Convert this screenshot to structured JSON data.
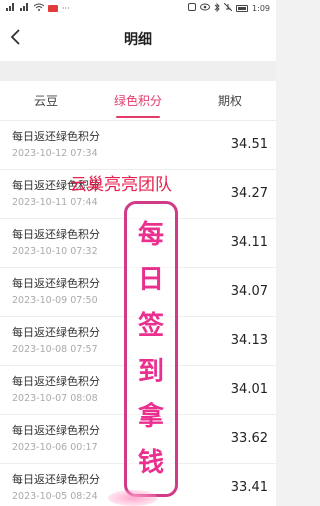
{
  "status_bar": {
    "time": "1:09",
    "battery_level": 0.8
  },
  "header": {
    "title": "明细",
    "back_icon": "chevron-left-icon"
  },
  "tabs": [
    {
      "label": "云豆",
      "active": false
    },
    {
      "label": "绿色积分",
      "active": true
    },
    {
      "label": "期权",
      "active": false
    }
  ],
  "records": [
    {
      "title": "每日返还绿色积分",
      "date": "2023-10-12 07:34",
      "amount": "34.51"
    },
    {
      "title": "每日返还绿色积分",
      "date": "2023-10-11 07:44",
      "amount": "34.27"
    },
    {
      "title": "每日返还绿色积分",
      "date": "2023-10-10 07:32",
      "amount": "34.11"
    },
    {
      "title": "每日返还绿色积分",
      "date": "2023-10-09 07:50",
      "amount": "34.07"
    },
    {
      "title": "每日返还绿色积分",
      "date": "2023-10-08 07:57",
      "amount": "34.13"
    },
    {
      "title": "每日返还绿色积分",
      "date": "2023-10-07 08:08",
      "amount": "34.01"
    },
    {
      "title": "每日返还绿色积分",
      "date": "2023-10-06 00:17",
      "amount": "33.62"
    },
    {
      "title": "每日返还绿色积分",
      "date": "2023-10-05 08:24",
      "amount": "33.41"
    }
  ],
  "overlay": {
    "team_text": "云巢亮亮团队",
    "slogan_chars": [
      "每",
      "日",
      "签",
      "到",
      "拿",
      "钱"
    ]
  },
  "colors": {
    "accent": "#e23b6a",
    "overlay_red": "#e8204e",
    "overlay_pink": "#ea2f8e"
  }
}
